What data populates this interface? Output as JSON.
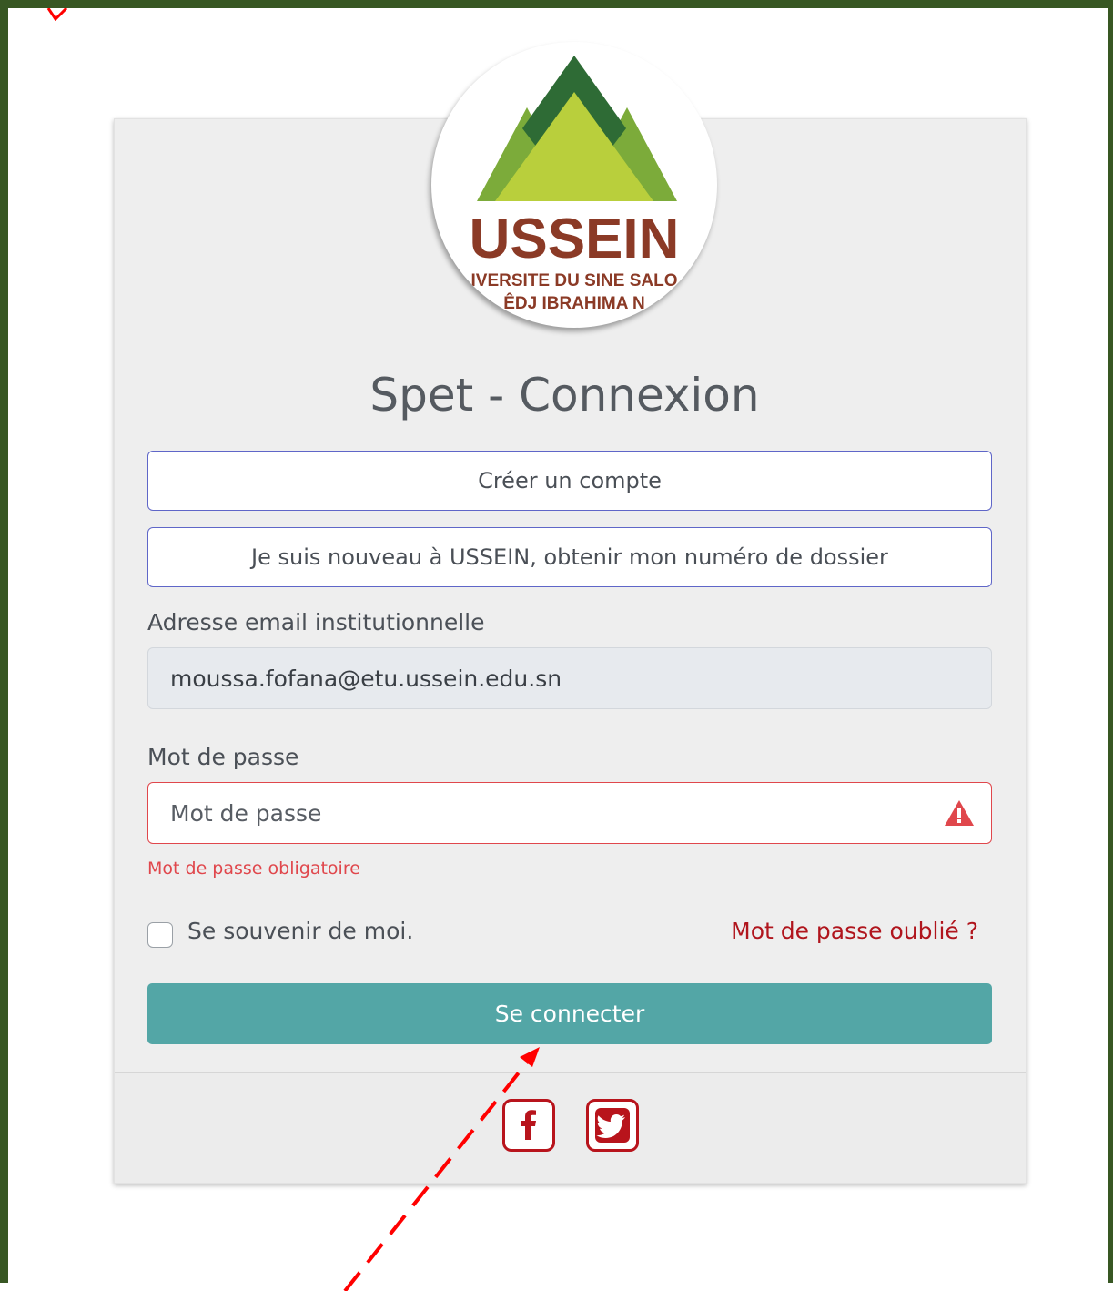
{
  "logo": {
    "acronym": "USSEIN",
    "line1": "IVERSITE DU SINE SALO",
    "line2": "ÊDJ IBRAHIMA N",
    "colors": {
      "dark_green": "#2e6b35",
      "mid_green": "#7cab3a",
      "light_green": "#b9cf3c",
      "brown": "#8b3a26"
    }
  },
  "page_title": "Spet - Connexion",
  "actions": {
    "create_account": "Créer un compte",
    "new_student": "Je suis nouveau à USSEIN, obtenir mon numéro de dossier"
  },
  "email": {
    "label": "Adresse email institutionnelle",
    "value": "moussa.fofana@etu.ussein.edu.sn"
  },
  "password": {
    "label": "Mot de passe",
    "placeholder": "Mot de passe",
    "error": "Mot de passe obligatoire"
  },
  "remember_me": "Se souvenir de moi.",
  "forgot_password": "Mot de passe oublié ?",
  "submit": "Se connecter",
  "social": [
    {
      "name": "facebook-icon"
    },
    {
      "name": "twitter-icon"
    }
  ],
  "colors": {
    "frame": "#385723",
    "submit": "#53a6a6",
    "error": "#e0474c",
    "link": "#b0151d",
    "outline": "#5f66c8"
  }
}
